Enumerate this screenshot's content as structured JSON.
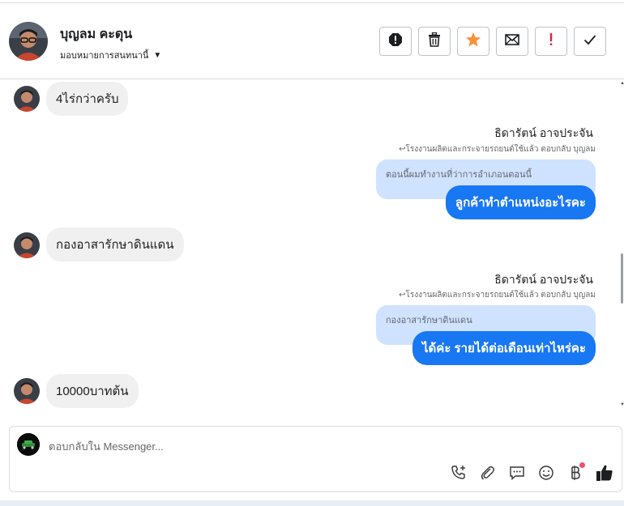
{
  "header": {
    "contact_name": "บุญลม คะดุน",
    "assign_label": "มอบหมายการสนทนานี้",
    "actions": [
      {
        "name": "report-button",
        "icon": "alert-octagon-icon"
      },
      {
        "name": "delete-button",
        "icon": "trash-icon"
      },
      {
        "name": "star-button",
        "icon": "star-icon",
        "color": "#f7923b"
      },
      {
        "name": "mark-unread-button",
        "icon": "envelope-icon"
      },
      {
        "name": "follow-up-button",
        "icon": "exclamation-icon",
        "color": "#e41e3f"
      },
      {
        "name": "mark-done-button",
        "icon": "check-icon"
      }
    ]
  },
  "messages": [
    {
      "type": "incoming",
      "text": "4ไร่กว่าครับ"
    },
    {
      "type": "outgoing",
      "sender": "ธิดารัตน์ อาจประจัน",
      "reply_meta": "↩โรงงานผลิตและกระจายรถยนต์ใช้แล้ว ตอบกลับ บุญลม",
      "quoted": "ตอนนี้ผมทำงานที่ว่าการอำเภอนตอนนี้",
      "text": "ลูกค้าทำตำแหน่งอะไรคะ"
    },
    {
      "type": "incoming",
      "text": "กองอาสารักษาดินแดน"
    },
    {
      "type": "outgoing",
      "sender": "ธิดารัตน์ อาจประจัน",
      "reply_meta": "↩โรงงานผลิตและกระจายรถยนต์ใช้แล้ว ตอบกลับ บุญลม",
      "quoted": "กองอาสารักษาดินแดน",
      "text": "ได้ค่ะ รายได้ต่อเดือนเท่าไหร่คะ"
    },
    {
      "type": "incoming",
      "text": "10000บาทต้น"
    }
  ],
  "composer": {
    "placeholder": "ตอบกลับใน Messenger...",
    "value": "",
    "icons": [
      "add-call-icon",
      "attachment-icon",
      "saved-reply-icon",
      "emoji-icon",
      "payment-icon",
      "like-icon"
    ]
  },
  "colors": {
    "outgoing_bubble": "#1877f2",
    "quoted_bubble": "#cfe2ff",
    "incoming_bubble": "#f0f0f0"
  }
}
